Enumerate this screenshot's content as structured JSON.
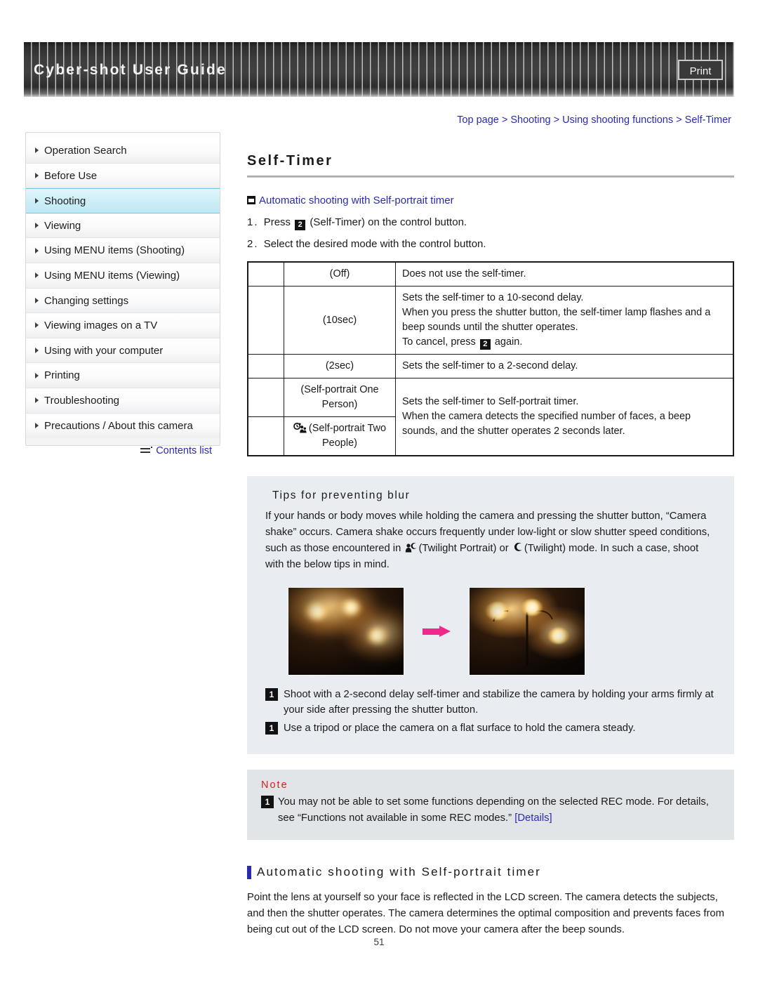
{
  "header": {
    "title": "Cyber-shot User Guide",
    "print_label": "Print"
  },
  "breadcrumb": {
    "items": [
      "Top page",
      "Shooting",
      "Using shooting functions",
      "Self-Timer"
    ],
    "separator": ">"
  },
  "sidebar": {
    "items": [
      {
        "label": "Operation Search",
        "active": false
      },
      {
        "label": "Before Use",
        "active": false
      },
      {
        "label": "Shooting",
        "active": true
      },
      {
        "label": "Viewing",
        "active": false
      },
      {
        "label": "Using MENU items (Shooting)",
        "active": false
      },
      {
        "label": "Using MENU items (Viewing)",
        "active": false
      },
      {
        "label": "Changing settings",
        "active": false
      },
      {
        "label": "Viewing images on a TV",
        "active": false
      },
      {
        "label": "Using with your computer",
        "active": false
      },
      {
        "label": "Printing",
        "active": false
      },
      {
        "label": "Troubleshooting",
        "active": false
      },
      {
        "label": "Precautions / About this camera",
        "active": false
      }
    ],
    "contents_link": "Contents list"
  },
  "main": {
    "page_title": "Self-Timer",
    "section_link": "Automatic shooting with Self-portrait timer",
    "steps": [
      {
        "num": "1.",
        "pre": "Press",
        "icon": "self-timer-glyph",
        "post": "(Self-Timer) on the control button."
      },
      {
        "num": "2.",
        "pre": "Select the desired mode with the control button.",
        "icon": "",
        "post": ""
      }
    ],
    "table": {
      "rows": [
        {
          "label": "(Off)",
          "icon": "",
          "desc_lines": [
            "Does not use the self-timer."
          ]
        },
        {
          "label": "(10sec)",
          "icon": "",
          "desc_lines": [
            "Sets the self-timer to a 10-second delay.",
            "When you press the shutter button, the self-timer lamp flashes and a beep sounds until the shutter operates.",
            "To cancel, press [timer] again."
          ]
        },
        {
          "label": "(2sec)",
          "icon": "",
          "desc_lines": [
            "Sets the self-timer to a 2-second delay."
          ]
        },
        {
          "label": "(Self-portrait One Person)",
          "icon": "",
          "desc_lines": [
            "Sets the self-timer to Self-portrait timer.",
            "When the camera detects the specified number of faces, a beep sounds, and the shutter operates 2 seconds later."
          ]
        },
        {
          "label": "(Self-portrait Two People)",
          "icon": "self-portrait-two-people-icon",
          "desc_lines": []
        }
      ]
    },
    "tips": {
      "title": "Tips for preventing blur",
      "body_part_1": "If your hands or body moves while holding the camera and pressing the shutter button, “Camera shake” occurs. Camera shake occurs frequently under low-light or slow shutter speed conditions, such as those encountered in",
      "body_part_2": "(Twilight Portrait) or",
      "body_part_3": "(Twilight) mode. In such a case, shoot with the below tips in mind.",
      "bullets": [
        "Shoot with a 2-second delay self-timer and stabilize the camera by holding your arms firmly at your side after pressing the shutter button.",
        "Use a tripod or place the camera on a flat surface to hold the camera steady."
      ],
      "figure_left_alt": "blurry-photo",
      "figure_right_alt": "sharp-photo",
      "arrow_color": "#f0288c"
    },
    "note": {
      "title": "Note",
      "text_before_link": "You may not be able to set some functions depending on the selected REC mode. For details, see “Functions not available in some REC modes.”",
      "link_label": "[Details]"
    },
    "bottom": {
      "heading": "Automatic shooting with Self-portrait timer",
      "body": "Point the lens at yourself so your face is reflected in the LCD screen. The camera detects the subjects, and then the shutter operates. The camera determines the optimal composition and prevents faces from being cut out of the LCD screen. Do not move your camera after the beep sounds."
    },
    "page_number": "51"
  },
  "colors": {
    "link_blue": "#2a2ab0",
    "note_red": "#d42020",
    "tips_bg": "#e9edf2",
    "note_bg": "#e2e5e8",
    "active_nav": "#bfe9f5"
  }
}
